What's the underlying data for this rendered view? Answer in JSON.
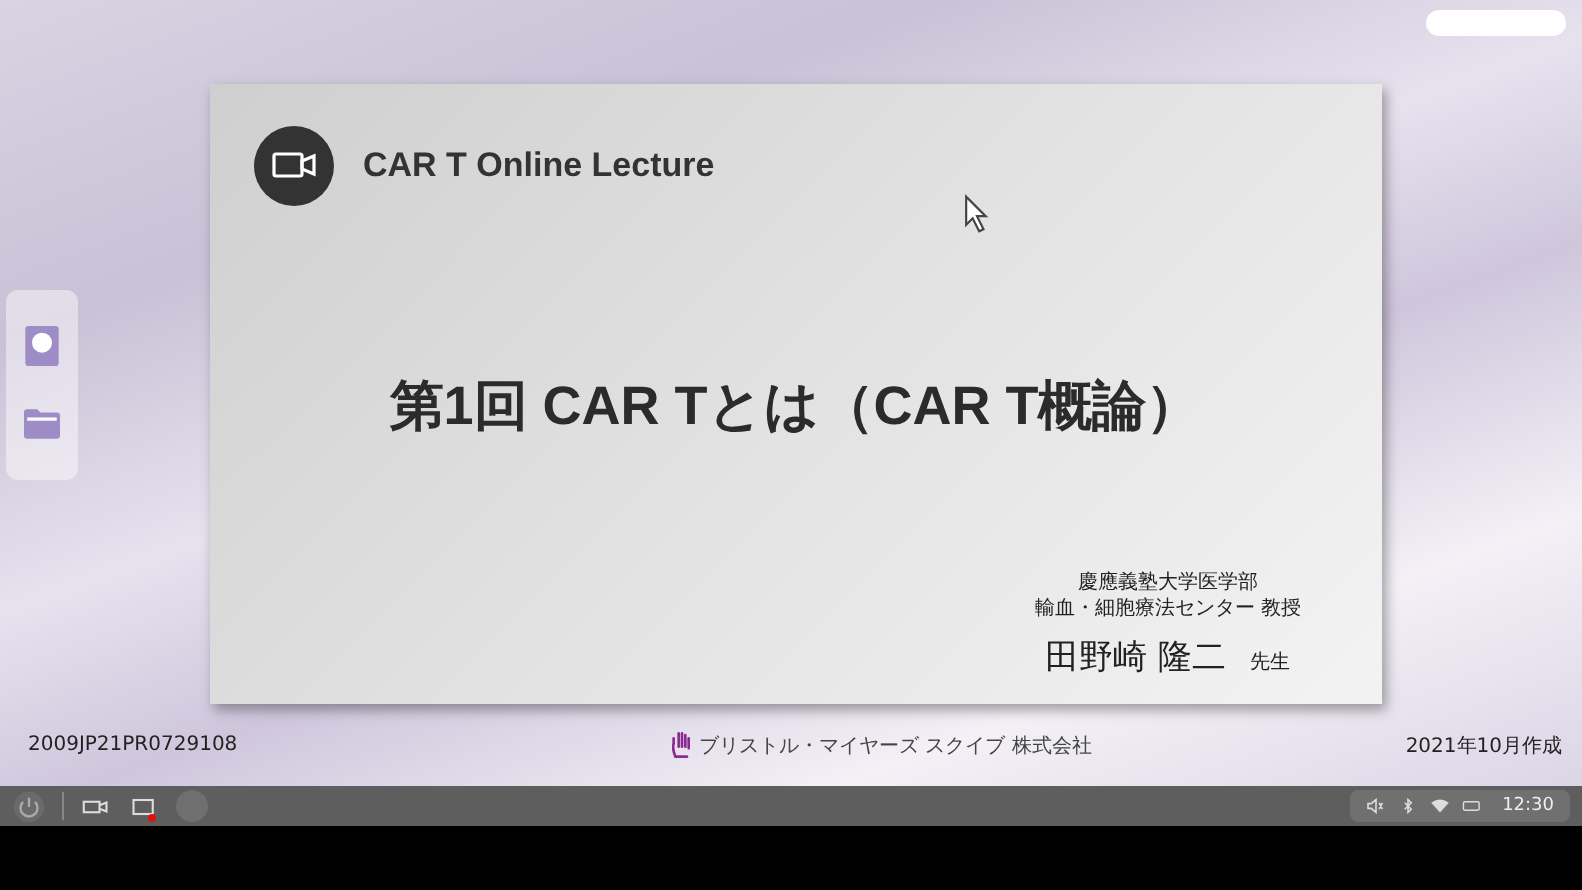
{
  "slide": {
    "header_title": "CAR T Online Lecture",
    "title": "第1回 CAR Tとは（CAR T概論）",
    "affiliation": [
      "慶應義塾大学医学部",
      "輸血・細胞療法センター 教授"
    ],
    "presenter_name": "田野崎 隆二",
    "honorific": "先生"
  },
  "footer": {
    "code": "2009JP21PR0729108",
    "company": "ブリストル・マイヤーズ スクイブ 株式会社",
    "date": "2021年10月作成"
  },
  "taskbar": {
    "apps": [
      {
        "kind": "camera",
        "running": false
      },
      {
        "kind": "screen",
        "running": true
      }
    ],
    "time": "12:30"
  }
}
